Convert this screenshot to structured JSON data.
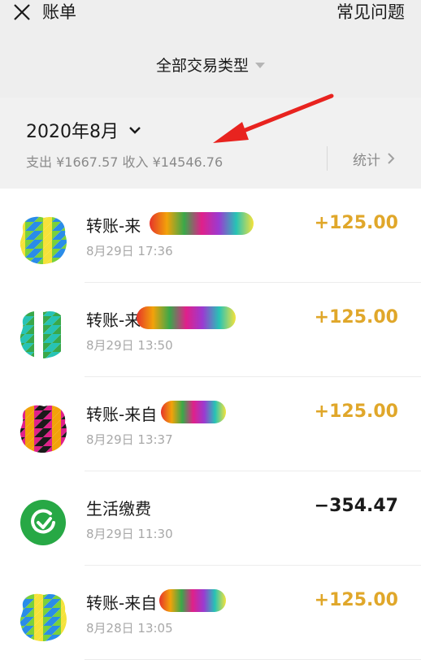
{
  "header": {
    "title": "账单",
    "faq_label": "常见问题"
  },
  "filter": {
    "label": "全部交易类型"
  },
  "month": {
    "label": "2020年8月",
    "summary_expense": "支出 ¥1667.57",
    "summary_income": "收入 ¥14546.76",
    "stats_label": "统计"
  },
  "colors": {
    "income": "#e0a72a",
    "expense": "#1a1a1a",
    "annotation_arrow": "#e8231f",
    "utility_icon": "#27a845"
  },
  "transactions": [
    {
      "title": "转账-来",
      "time": "8月29日 17:36",
      "amount": "+125.00",
      "kind": "income",
      "icon": "redacted-avatar"
    },
    {
      "title": "转账-来",
      "time": "8月29日 13:50",
      "amount": "+125.00",
      "kind": "income",
      "icon": "redacted-avatar"
    },
    {
      "title": "转账-来自",
      "time": "8月29日 13:37",
      "amount": "+125.00",
      "kind": "income",
      "icon": "redacted-avatar"
    },
    {
      "title": "生活缴费",
      "time": "8月29日 11:30",
      "amount": "−354.47",
      "kind": "expense",
      "icon": "utility-payment-icon"
    },
    {
      "title": "转账-来自",
      "time": "8月28日 13:05",
      "amount": "+125.00",
      "kind": "income",
      "icon": "redacted-avatar"
    }
  ]
}
